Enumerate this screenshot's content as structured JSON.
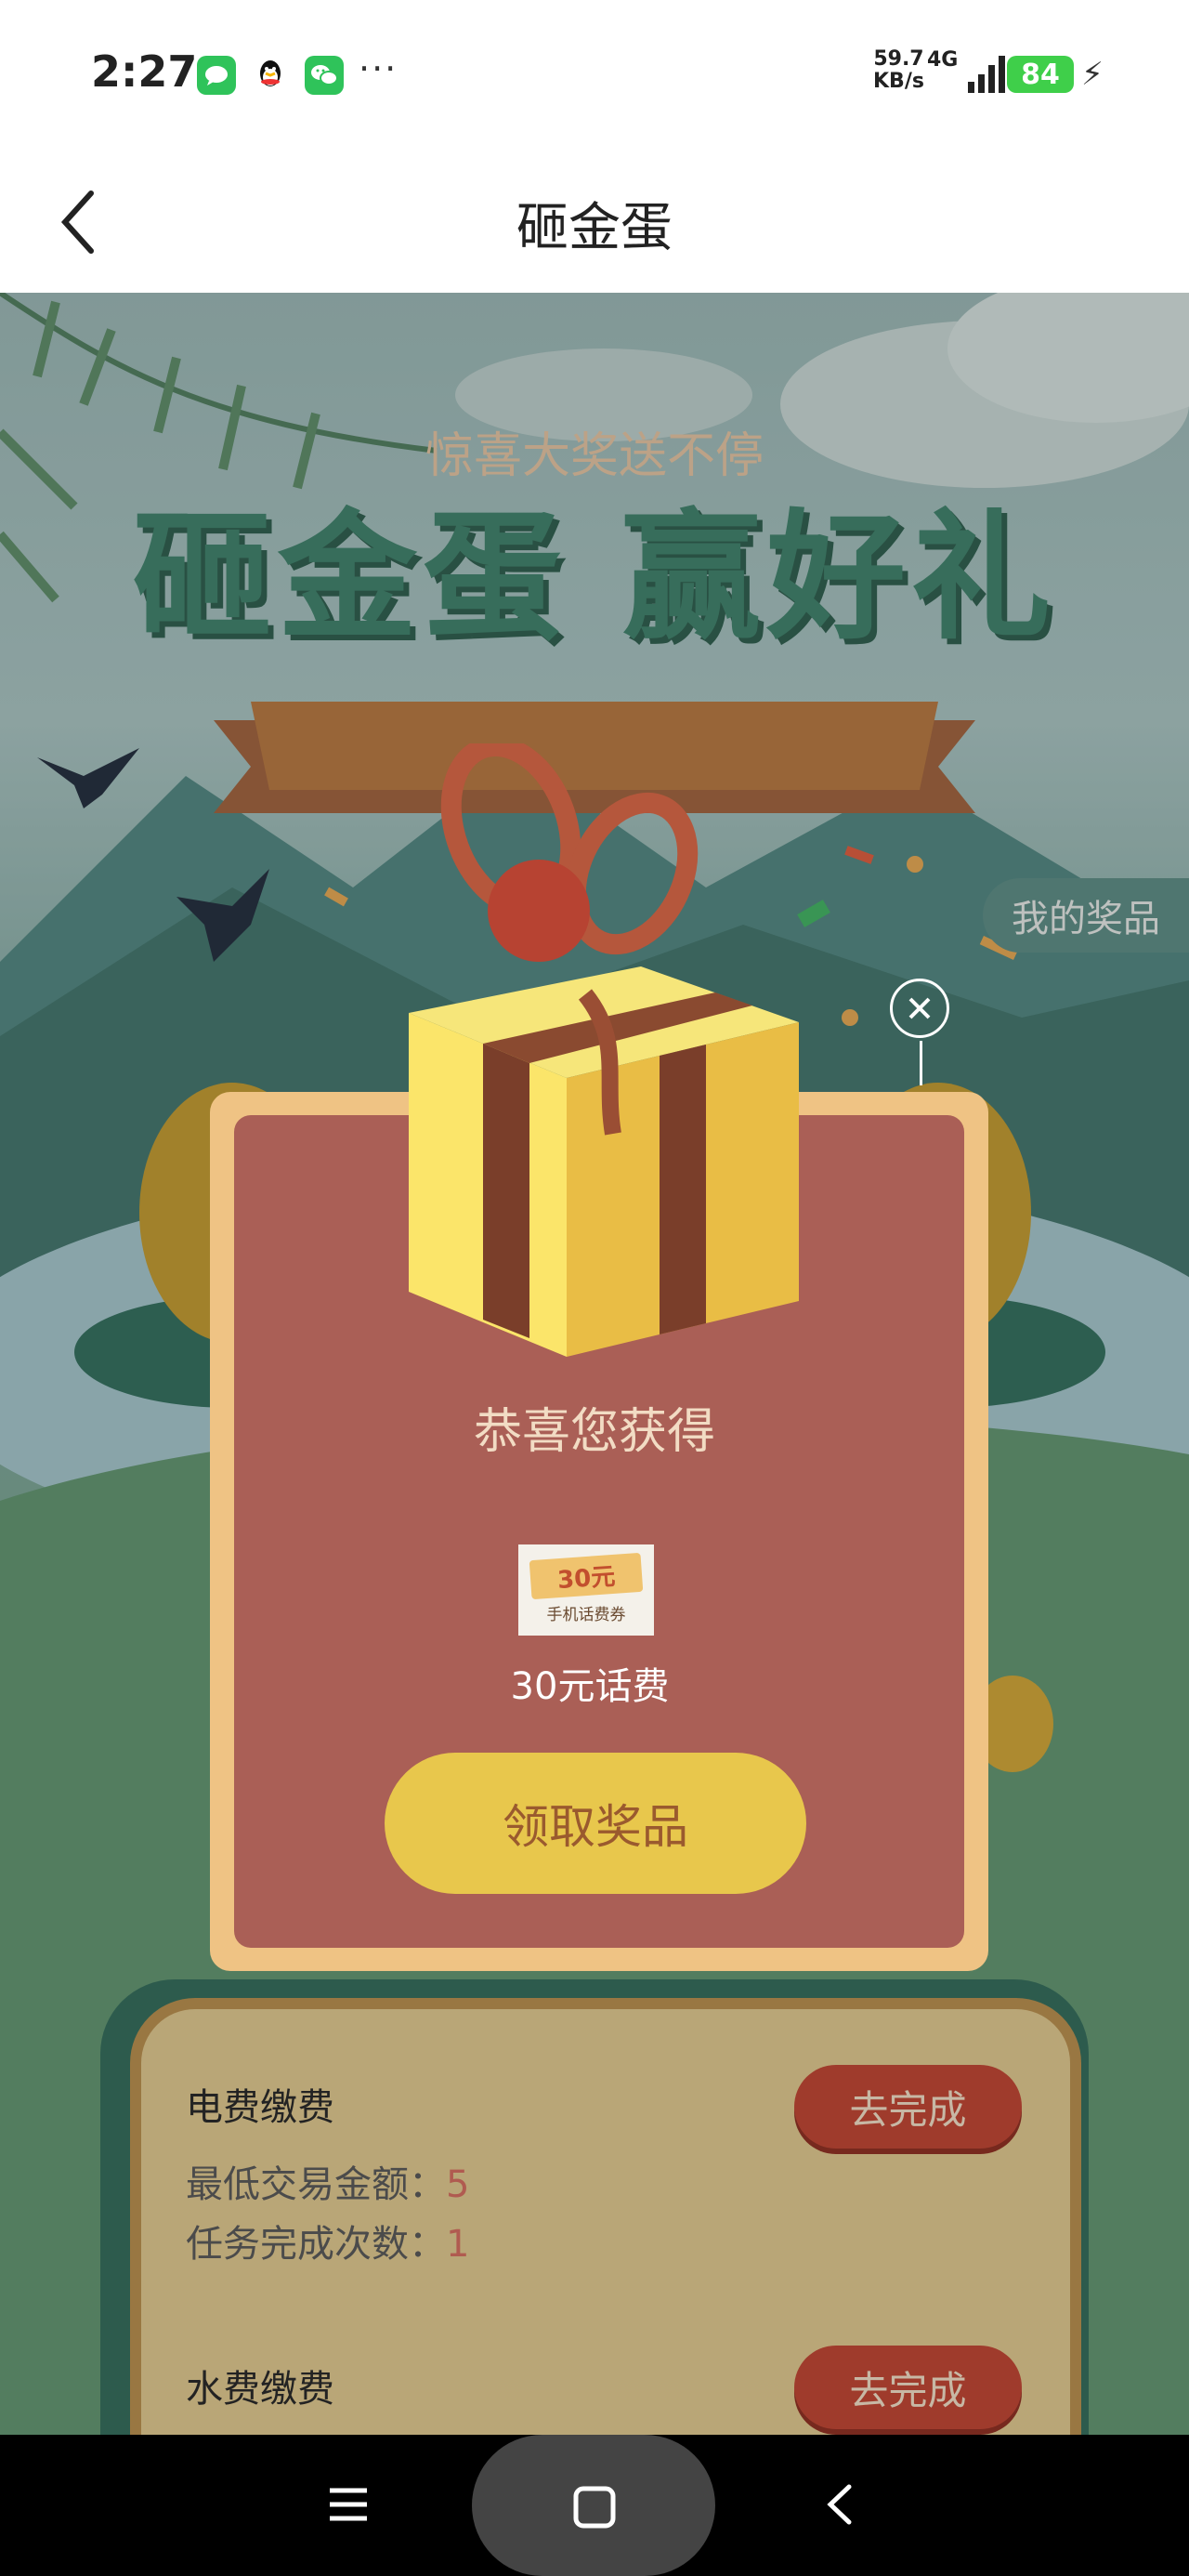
{
  "status_bar": {
    "time": "2:27",
    "net_speed": "59.7",
    "net_unit": "KB/s",
    "network_type": "4G",
    "battery": "84",
    "notification_icons": [
      "messages-icon",
      "qq-icon",
      "wechat-icon"
    ],
    "overflow": "···"
  },
  "header": {
    "title": "砸金蛋"
  },
  "hero": {
    "headline": "砸金蛋 赢好礼",
    "ribbon_text": "惊喜大奖送不停",
    "my_prizes_label": "我的奖品"
  },
  "modal": {
    "congrats": "恭喜您获得",
    "coupon_amount": "30元",
    "coupon_caption": "手机话费券",
    "prize_name": "30元话费",
    "claim_button": "领取奖品"
  },
  "tasks": [
    {
      "title": "电费缴费",
      "min_amount_label": "最低交易金额：",
      "min_amount": "5",
      "count_label": "任务完成次数：",
      "count": "1",
      "button": "去完成"
    },
    {
      "title": "水费缴费",
      "button": "去完成"
    }
  ],
  "colors": {
    "accent_green": "#3c8069",
    "modal_bg": "#aa5f56",
    "modal_border": "#efc384",
    "claim_button": "#e8c74c",
    "task_button": "#c0402e"
  }
}
